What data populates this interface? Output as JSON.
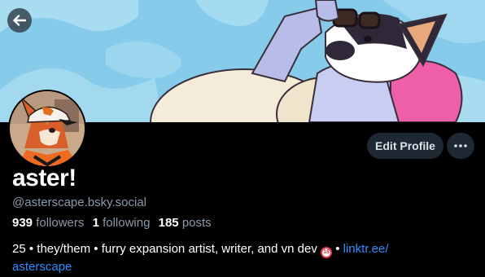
{
  "colors": {
    "background": "#000000",
    "banner_sky": "#7ec8e8",
    "button_bg": "#1e2833",
    "link": "#2f8cff",
    "muted_text": "#8a99a8"
  },
  "profile": {
    "display_name": "aster!",
    "handle": "@asterscape.bsky.social",
    "edit_label": "Edit Profile",
    "more_icon": "ellipsis-icon",
    "back_icon": "arrow-left-icon"
  },
  "stats": {
    "followers_count": "939",
    "followers_label": "followers",
    "following_count": "1",
    "following_label": "following",
    "posts_count": "185",
    "posts_label": "posts"
  },
  "bio": {
    "text_before": "25 • they/them • furry expansion artist, writer, and vn dev",
    "badge": "18",
    "separator": "•",
    "link_line1": "linktr.ee/",
    "link_line2": "asterscape"
  }
}
